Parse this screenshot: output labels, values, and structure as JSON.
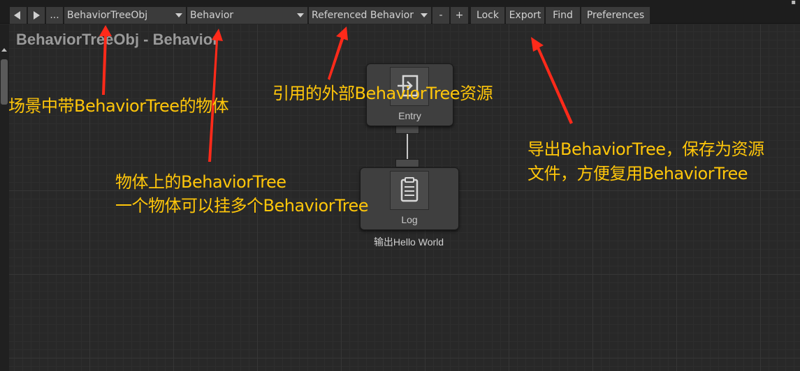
{
  "toolbar": {
    "more_label": "...",
    "object_select": "BehaviorTreeObj",
    "behavior_select": "Behavior",
    "referenced_select": "Referenced Behavior",
    "minus_label": "-",
    "plus_label": "+",
    "lock_label": "Lock",
    "export_label": "Export",
    "find_label": "Find",
    "preferences_label": "Preferences"
  },
  "graph": {
    "title": "BehaviorTreeObj - Behavior",
    "nodes": [
      {
        "label": "Entry",
        "icon": "entry-icon"
      },
      {
        "label": "Log",
        "icon": "clipboard-icon",
        "comment": "输出Hello World"
      }
    ]
  },
  "annotations": {
    "scene_object": "场景中带BehaviorTree的物体",
    "referenced": "引用的外部BehaviorTree资源",
    "object_tree_line1": "物体上的BehaviorTree",
    "object_tree_line2": "一个物体可以挂多个BehaviorTree",
    "export_line1": "导出BehaviorTree，保存为资源",
    "export_line2": "文件，方便复用BehaviorTree"
  },
  "colors": {
    "annotation_text": "#ffc60a",
    "arrow": "#ff2a1a",
    "canvas_bg": "#282828"
  }
}
